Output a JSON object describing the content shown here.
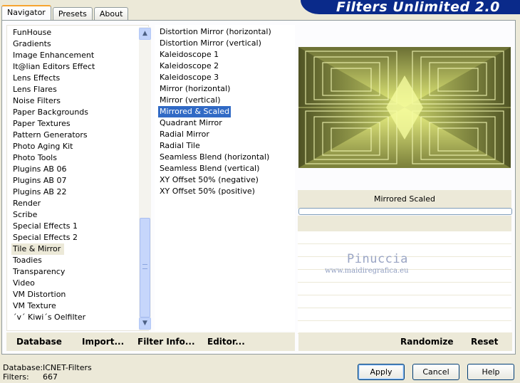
{
  "tabs": [
    {
      "label": "Navigator"
    },
    {
      "label": "Presets"
    },
    {
      "label": "About"
    }
  ],
  "app_title": "Filters Unlimited 2.0",
  "categories": [
    "FunHouse",
    "Gradients",
    "Image Enhancement",
    "It@lian Editors Effect",
    "Lens Effects",
    "Lens Flares",
    "Noise Filters",
    "Paper Backgrounds",
    "Paper Textures",
    "Pattern Generators",
    "Photo Aging Kit",
    "Photo Tools",
    "Plugins AB 06",
    "Plugins AB 07",
    "Plugins AB 22",
    "Render",
    "Scribe",
    "Special Effects 1",
    "Special Effects 2",
    "Tile & Mirror",
    "Toadies",
    "Transparency",
    "Video",
    "VM Distortion",
    "VM Texture",
    "´v´ Kiwi´s Oelfilter"
  ],
  "selected_category": "Tile & Mirror",
  "filters": [
    "Distortion Mirror (horizontal)",
    "Distortion Mirror (vertical)",
    "Kaleidoscope 1",
    "Kaleidoscope 2",
    "Kaleidoscope 3",
    "Mirror (horizontal)",
    "Mirror (vertical)",
    "Mirrored & Scaled",
    "Quadrant Mirror",
    "Radial Mirror",
    "Radial Tile",
    "Seamless Blend (horizontal)",
    "Seamless Blend (vertical)",
    "XY Offset 50% (negative)",
    "XY Offset 50% (positive)"
  ],
  "selected_filter": "Mirrored & Scaled",
  "effect_label": "Mirrored  Scaled",
  "watermark": {
    "name": "Pinuccia",
    "url": "www.maidiregrafica.eu"
  },
  "bottom_left": {
    "database": "Database",
    "import": "Import...",
    "filter_info": "Filter Info...",
    "editor": "Editor..."
  },
  "bottom_right": {
    "randomize": "Randomize",
    "reset": "Reset"
  },
  "status": {
    "database_key": "Database:",
    "database_val": "ICNET-Filters",
    "filters_key": "Filters:",
    "filters_val": "667"
  },
  "buttons": {
    "apply": "Apply",
    "cancel": "Cancel",
    "help": "Help"
  },
  "colors": {
    "banner": "#0a2a8a",
    "selection": "#316ac5",
    "preview_light": "#e8f27a",
    "preview_dark": "#4a4e24"
  }
}
